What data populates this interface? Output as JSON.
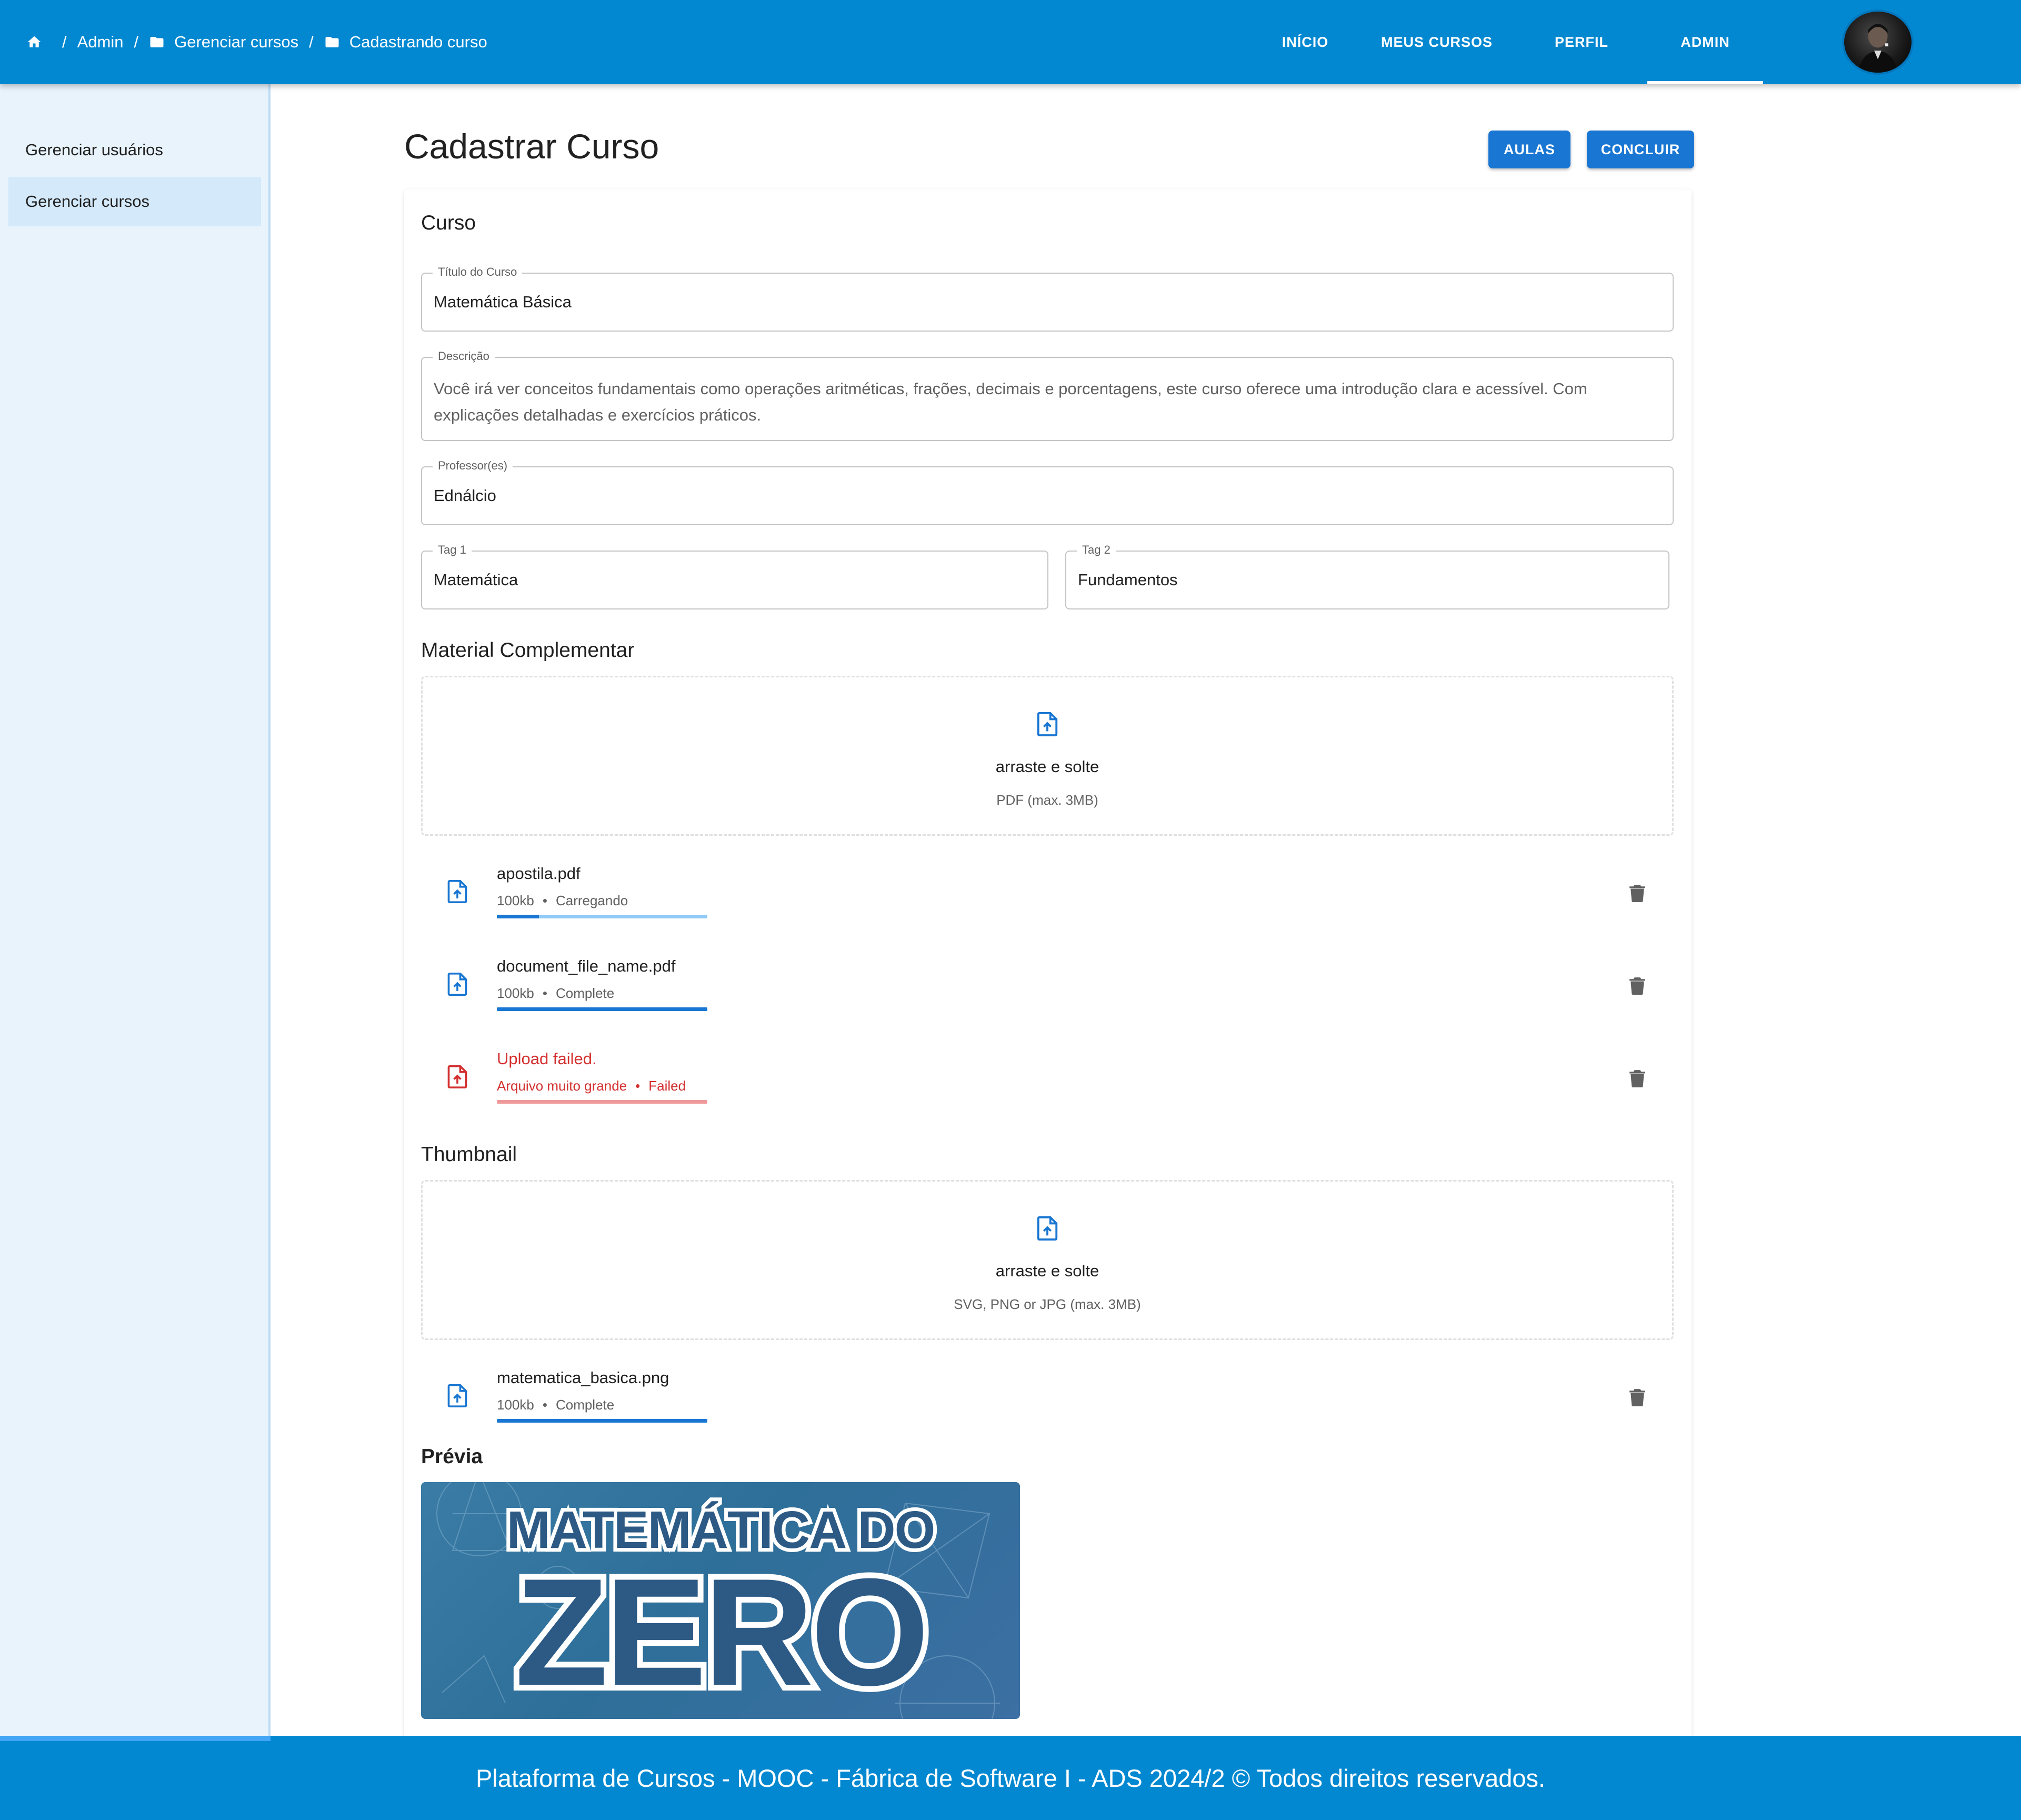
{
  "breadcrumb": [
    {
      "label": "Admin"
    },
    {
      "label": "Gerenciar cursos"
    },
    {
      "label": "Cadastrando curso"
    }
  ],
  "nav": [
    {
      "label": "INÍCIO",
      "active": false
    },
    {
      "label": "MEUS CURSOS",
      "active": false
    },
    {
      "label": "PERFIL",
      "active": false
    },
    {
      "label": "ADMIN",
      "active": true
    }
  ],
  "sidebar": {
    "items": [
      {
        "label": "Gerenciar usuários",
        "selected": false
      },
      {
        "label": "Gerenciar cursos",
        "selected": true
      }
    ]
  },
  "page": {
    "title": "Cadastrar Curso",
    "aulas_button": "AULAS",
    "concluir_button": "CONCLUIR"
  },
  "curso": {
    "section_title": "Curso",
    "titulo": {
      "label": "Título do Curso",
      "value": "Matemática Básica"
    },
    "descricao": {
      "label": "Descrição",
      "value": "Você irá ver conceitos fundamentais como operações aritméticas, frações, decimais e porcentagens, este curso oferece uma introdução clara e acessível. Com explicações detalhadas e exercícios práticos."
    },
    "professor": {
      "label": "Professor(es)",
      "value": "Ednálcio"
    },
    "tag1": {
      "label": "Tag 1",
      "value": "Matemática"
    },
    "tag2": {
      "label": "Tag 2",
      "value": "Fundamentos"
    }
  },
  "material": {
    "section_title": "Material Complementar",
    "dropzone": {
      "main": "arraste e solte",
      "sub": "PDF (max. 3MB)"
    },
    "files": [
      {
        "name": "apostila.pdf",
        "size": "100kb",
        "status": "Carregando",
        "progress": 0.2,
        "state": "loading"
      },
      {
        "name": "document_file_name.pdf",
        "size": "100kb",
        "status": "Complete",
        "progress": 1.0,
        "state": "complete"
      },
      {
        "name": "Upload failed.",
        "size": "Arquivo muito grande",
        "status": "Failed",
        "progress": 1.0,
        "state": "error"
      }
    ]
  },
  "thumbnail": {
    "section_title": "Thumbnail",
    "dropzone": {
      "main": "arraste e solte",
      "sub": "SVG, PNG or JPG (max. 3MB)"
    },
    "file": {
      "name": "matematica_basica.png",
      "size": "100kb",
      "status": "Complete",
      "progress": 1.0
    }
  },
  "previa": {
    "section_title": "Prévia",
    "image_line1": "MATEMÁTICA DO",
    "image_line2": "ZERO"
  },
  "footer": {
    "text": "Plataforma de Cursos - MOOC - Fábrica de Software I - ADS 2024/2  ©  Todos direitos reservados."
  },
  "colors": {
    "primary": "#0288d1",
    "button": "#1976d2",
    "error": "#d32f2f",
    "sidebar_bg": "#e8f3fc"
  }
}
